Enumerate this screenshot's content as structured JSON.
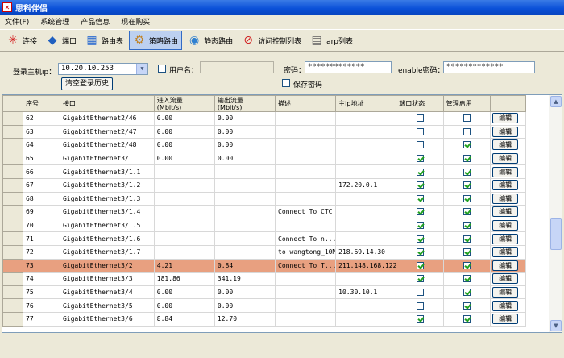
{
  "app": {
    "title": "思科伴侣"
  },
  "menu": [
    {
      "label": "文件(F)"
    },
    {
      "label": "系统管理"
    },
    {
      "label": "产品信息"
    },
    {
      "label": "现在购买"
    }
  ],
  "toolbar": [
    {
      "label": "连接",
      "icon": "connect-icon",
      "active": false
    },
    {
      "label": "端口",
      "icon": "port-icon",
      "active": false
    },
    {
      "label": "路由表",
      "icon": "route-table-icon",
      "active": false
    },
    {
      "label": "策略路由",
      "icon": "policy-route-icon",
      "active": true
    },
    {
      "label": "静态路由",
      "icon": "static-route-icon",
      "active": false
    },
    {
      "label": "访问控制列表",
      "icon": "acl-icon",
      "active": false
    },
    {
      "label": "arp列表",
      "icon": "arp-icon",
      "active": false
    }
  ],
  "login": {
    "host_label": "登录主机ip：",
    "host_value": "10.20.10.253",
    "username_label": "用户名：",
    "username_value": "",
    "password_label": "密码：",
    "password_value": "*************",
    "enable_label": "enable密码：",
    "enable_value": "*************",
    "save_label": "保存密码",
    "clear_history_label": "清空登录历史"
  },
  "table": {
    "columns": [
      "序号",
      "接口",
      "进入流量\n(Mbit/s)",
      "输出流量\n(Mbit/s)",
      "描述",
      "主ip地址",
      "端口状态",
      "管理启用",
      ""
    ],
    "edit_label": "编辑",
    "rows": [
      {
        "no": "62",
        "iface": "GigabitEthernet2/46",
        "in": "0.00",
        "out": "0.00",
        "desc": "",
        "ip": "",
        "port": false,
        "admin": false
      },
      {
        "no": "63",
        "iface": "GigabitEthernet2/47",
        "in": "0.00",
        "out": "0.00",
        "desc": "",
        "ip": "",
        "port": false,
        "admin": false
      },
      {
        "no": "64",
        "iface": "GigabitEthernet2/48",
        "in": "0.00",
        "out": "0.00",
        "desc": "",
        "ip": "",
        "port": false,
        "admin": true
      },
      {
        "no": "65",
        "iface": "GigabitEthernet3/1",
        "in": "0.00",
        "out": "0.00",
        "desc": "",
        "ip": "",
        "port": true,
        "admin": true
      },
      {
        "no": "66",
        "iface": "GigabitEthernet3/1.1",
        "in": "",
        "out": "",
        "desc": "",
        "ip": "",
        "port": true,
        "admin": true
      },
      {
        "no": "67",
        "iface": "GigabitEthernet3/1.2",
        "in": "",
        "out": "",
        "desc": "",
        "ip": "172.20.0.1",
        "port": true,
        "admin": true
      },
      {
        "no": "68",
        "iface": "GigabitEthernet3/1.3",
        "in": "",
        "out": "",
        "desc": "",
        "ip": "",
        "port": true,
        "admin": true
      },
      {
        "no": "69",
        "iface": "GigabitEthernet3/1.4",
        "in": "",
        "out": "",
        "desc": "Connect To CTC",
        "ip": "",
        "port": true,
        "admin": true
      },
      {
        "no": "70",
        "iface": "GigabitEthernet3/1.5",
        "in": "",
        "out": "",
        "desc": "",
        "ip": "",
        "port": true,
        "admin": true
      },
      {
        "no": "71",
        "iface": "GigabitEthernet3/1.6",
        "in": "",
        "out": "",
        "desc": "Connect To n...",
        "ip": "",
        "port": true,
        "admin": true
      },
      {
        "no": "72",
        "iface": "GigabitEthernet3/1.7",
        "in": "",
        "out": "",
        "desc": "to wangtong_10M",
        "ip": "218.69.14.30",
        "port": true,
        "admin": true
      },
      {
        "no": "73",
        "iface": "GigabitEthernet3/2",
        "in": "4.21",
        "out": "0.84",
        "desc": "Connect To T...",
        "ip": "211.148.168.122",
        "port": true,
        "admin": true,
        "selected": true
      },
      {
        "no": "74",
        "iface": "GigabitEthernet3/3",
        "in": "181.86",
        "out": "341.19",
        "desc": "",
        "ip": "",
        "port": true,
        "admin": true
      },
      {
        "no": "75",
        "iface": "GigabitEthernet3/4",
        "in": "0.00",
        "out": "0.00",
        "desc": "",
        "ip": "10.30.10.1",
        "port": false,
        "admin": true
      },
      {
        "no": "76",
        "iface": "GigabitEthernet3/5",
        "in": "0.00",
        "out": "0.00",
        "desc": "",
        "ip": "",
        "port": false,
        "admin": true
      },
      {
        "no": "77",
        "iface": "GigabitEthernet3/6",
        "in": "8.84",
        "out": "12.70",
        "desc": "",
        "ip": "",
        "port": true,
        "admin": true
      }
    ]
  }
}
